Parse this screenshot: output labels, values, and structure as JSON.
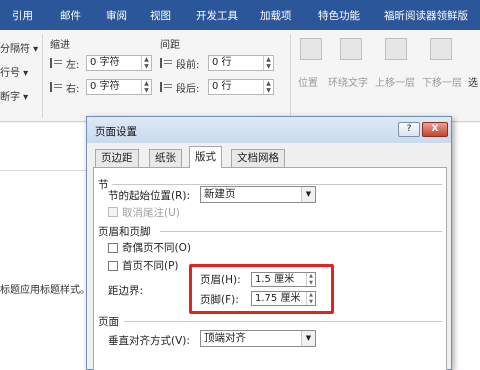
{
  "ribbon_tabs": [
    "引用",
    "邮件",
    "审阅",
    "视图",
    "开发工具",
    "加载项",
    "特色功能",
    "福昕阅读器领鲜版"
  ],
  "colors": {
    "ribbon": "#2b579a",
    "highlight": "#e02424"
  },
  "ribbon": {
    "left_cut": [
      "分隔符",
      "行号",
      "断字"
    ],
    "indent_label": "缩进",
    "spacing_label": "间距",
    "indent_left_label": "左:",
    "indent_left_value": "0 字符",
    "indent_right_label": "右:",
    "indent_right_value": "0 字符",
    "spacing_before_label": "段前:",
    "spacing_before_value": "0 行",
    "spacing_after_label": "段后:",
    "spacing_after_value": "0 行",
    "arrange": [
      "位置",
      "环绕文字",
      "上移一层",
      "下移一层",
      "选"
    ]
  },
  "doc_fragment": "标题应用标题样式。",
  "dialog": {
    "title": "页面设置",
    "help_btn": "?",
    "close_btn": "X",
    "tabs": [
      "页边距",
      "纸张",
      "版式",
      "文档网格"
    ],
    "active_tab": "版式",
    "section_title": "节",
    "section_start_label": "节的起始位置(R):",
    "section_start_value": "新建页",
    "suppress_endnotes_label": "取消尾注(U)",
    "header_footer_title": "页眉和页脚",
    "odd_even_label": "奇偶页不同(O)",
    "first_page_label": "首页不同(P)",
    "from_edge_label": "距边界:",
    "header_label": "页眉(H):",
    "header_value": "1.5 厘米",
    "footer_label": "页脚(F):",
    "footer_value": "1.75 厘米",
    "page_title": "页面",
    "vertical_align_label": "垂直对齐方式(V):",
    "vertical_align_value": "顶端对齐"
  }
}
